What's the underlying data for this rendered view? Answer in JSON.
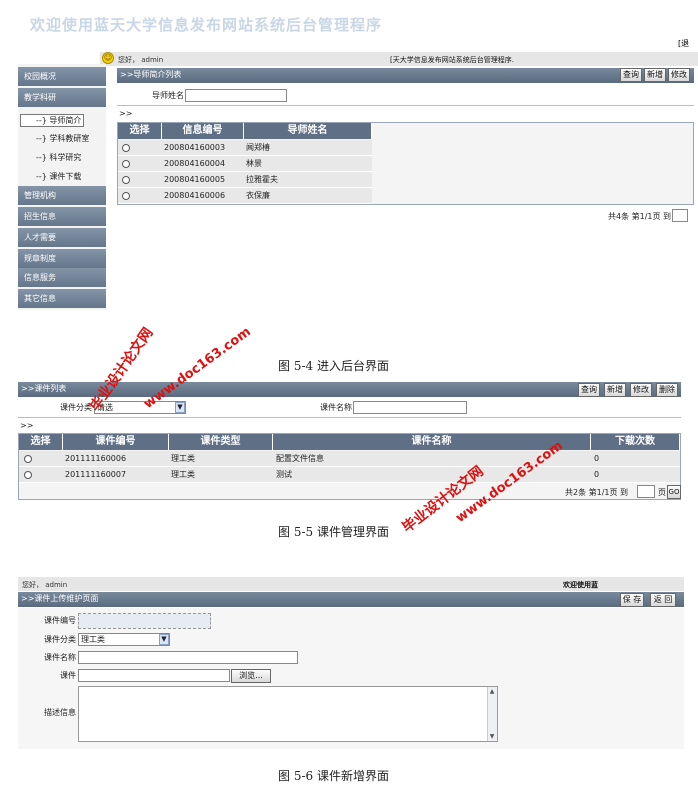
{
  "fig1": {
    "title": "欢迎使用蓝天大学信息发布网站系统后台管理程序",
    "corner": "[退",
    "greeting": "您好， admin",
    "banner": "[天大学信息发布网站系统后台管理程序.",
    "breadcrumb": ">>导师简介列表",
    "buttons": [
      "查询",
      "新增",
      "修改"
    ],
    "search_label": "导师姓名",
    "path": ">>",
    "sidebar": [
      {
        "label": "校园概况"
      },
      {
        "label": "教学科研"
      },
      {
        "label": "管理机构"
      },
      {
        "label": "招生信息"
      },
      {
        "label": "人才需要"
      },
      {
        "label": "规章制度"
      },
      {
        "label": "信息服务"
      },
      {
        "label": "其它信息"
      }
    ],
    "subitems": [
      "--} 导师简介",
      "--} 学科教研室",
      "--} 科学研究",
      "--} 课件下载"
    ],
    "columns": [
      "选择",
      "信息编号",
      "导师姓名"
    ],
    "rows": [
      {
        "id": "200804160003",
        "name": "闻郑椿"
      },
      {
        "id": "200804160004",
        "name": "林景"
      },
      {
        "id": "200804160005",
        "name": "拉雅霍夫"
      },
      {
        "id": "200804160006",
        "name": "衣保廉"
      }
    ],
    "pager": "共4条 第1/1页 到"
  },
  "caption1": "图 5-4    进入后台界面",
  "fig2": {
    "breadcrumb": ">>课件列表",
    "buttons": [
      "查询",
      "新增",
      "修改",
      "删除"
    ],
    "category_label": "课件分类",
    "category_value": "请选",
    "name_label": "课件名称",
    "path": ">>",
    "columns": [
      "选择",
      "课件编号",
      "课件类型",
      "课件名称",
      "下载次数"
    ],
    "rows": [
      {
        "id": "201111160006",
        "type": "理工类",
        "name": "配置文件信息",
        "count": "0"
      },
      {
        "id": "201111160007",
        "type": "理工类",
        "name": "测试",
        "count": "0"
      }
    ],
    "pager_left": "共2条 第1/1页 到",
    "pager_right": "页",
    "go": "GO"
  },
  "caption2": "图 5-5    课件管理界面",
  "fig3": {
    "greeting": "您好， admin",
    "welcome": "欢迎使用蓝",
    "breadcrumb": ">>课件上传维护页面",
    "buttons": [
      "保 存",
      "返 回"
    ],
    "fields": {
      "id_label": "课件编号",
      "category_label": "课件分类",
      "category_value": "理工类",
      "name_label": "课件名称",
      "file_label": "课件",
      "browse": "浏览...",
      "desc_label": "描述信息"
    }
  },
  "caption3": "图 5-6    课件新增界面",
  "watermark": {
    "cn": "毕业设计论文网",
    "url": "www.doc163.com"
  }
}
